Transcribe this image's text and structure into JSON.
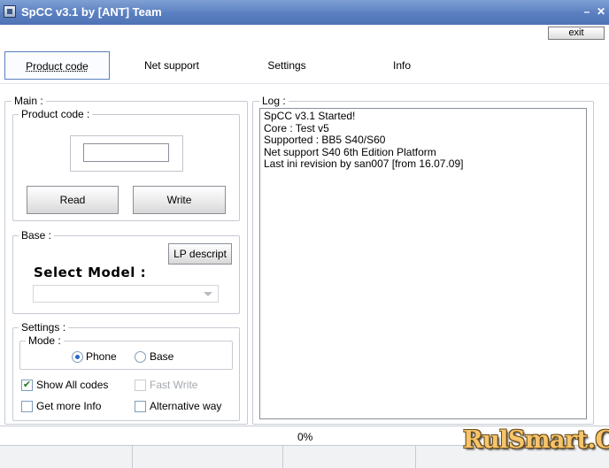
{
  "window": {
    "title": "SpCC v3.1 by [ANT] Team",
    "minimize_icon": "minimize-icon",
    "close_icon": "close-icon",
    "exit_label": "exit"
  },
  "tabs": [
    {
      "label": "Product code",
      "active": true
    },
    {
      "label": "Net support",
      "active": false
    },
    {
      "label": "Settings",
      "active": false
    },
    {
      "label": "Info",
      "active": false
    }
  ],
  "main": {
    "label": "Main :",
    "product_code": {
      "label": "Product code :",
      "value": "",
      "read_label": "Read",
      "write_label": "Write"
    },
    "base": {
      "label": "Base :",
      "lp_descript_label": "LP descript",
      "select_model_label": "Select Model :",
      "model_value": ""
    },
    "settings": {
      "label": "Settings :",
      "mode": {
        "label": "Mode :",
        "options": [
          {
            "label": "Phone",
            "selected": true
          },
          {
            "label": "Base",
            "selected": false
          }
        ]
      },
      "checkboxes": [
        {
          "label": "Show All codes",
          "checked": true,
          "enabled": true
        },
        {
          "label": "Fast Write",
          "checked": false,
          "enabled": false
        },
        {
          "label": "Get more Info",
          "checked": false,
          "enabled": true
        },
        {
          "label": "Alternative way",
          "checked": false,
          "enabled": true
        }
      ]
    }
  },
  "log": {
    "label": "Log :",
    "lines": [
      "SpCC v3.1 Started!",
      "Core : Test v5",
      "Supported : BB5 S40/S60",
      "Net support S40 6th Edition Platform",
      "Last ini revision by san007 [from 16.07.09]"
    ]
  },
  "status": {
    "progress_text": "0%",
    "progress": 0
  },
  "watermark": "RulSmart.Com",
  "colors": {
    "titlebar": "#5a7fc0",
    "tab_border": "#5a7fc0",
    "radio_dot": "#2a64c8",
    "watermark": "#f6c46a"
  }
}
